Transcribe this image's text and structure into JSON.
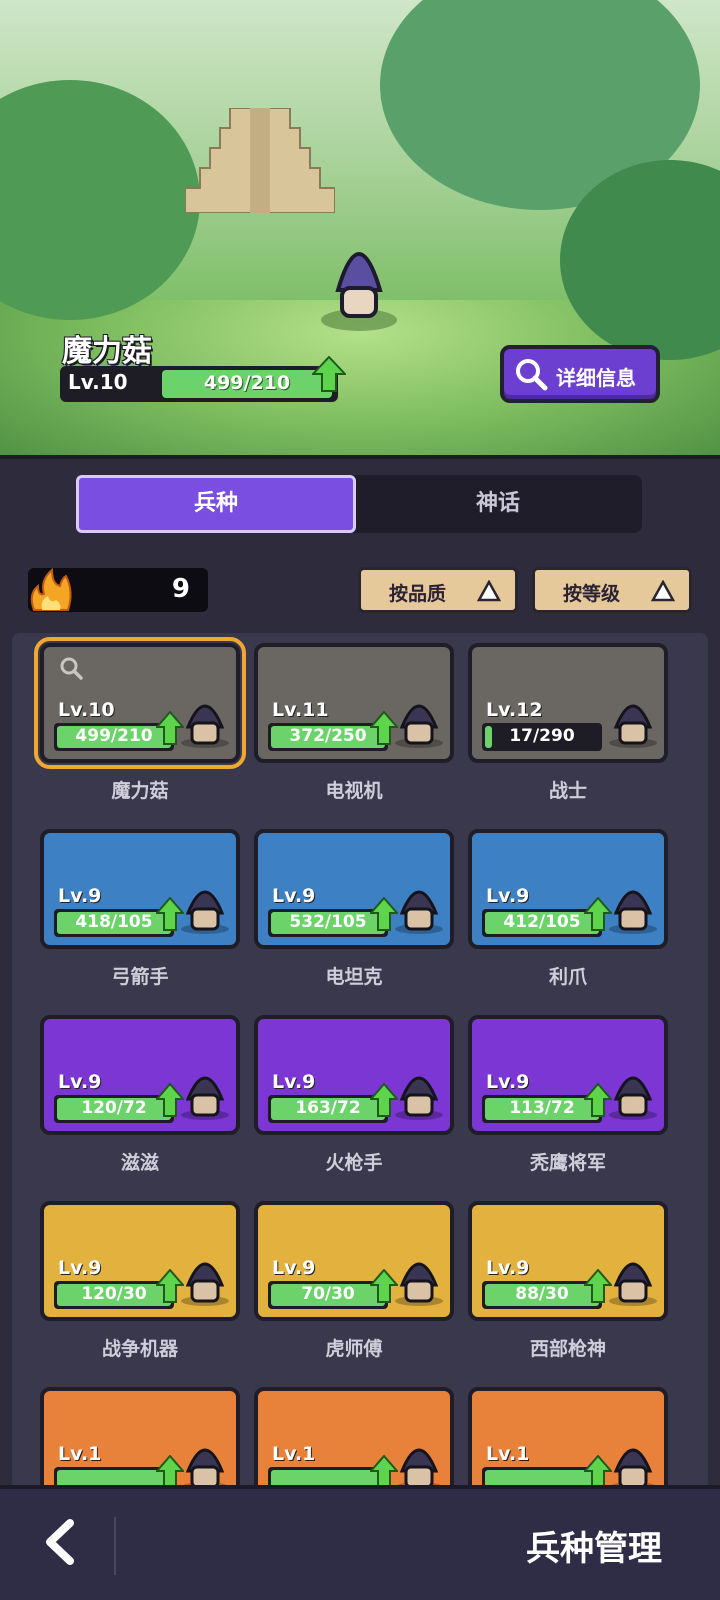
{
  "hero": {
    "unit_name": "魔力菇",
    "level": "Lv.10",
    "progress_text": "499/210",
    "progress_fraction": 1.0,
    "detail_button": "详细信息"
  },
  "tabs": [
    {
      "label": "兵种",
      "active": true
    },
    {
      "label": "神话",
      "active": false
    }
  ],
  "resource": {
    "icon": "fire-icon",
    "count": "9"
  },
  "sort_buttons": [
    {
      "label": "按品质",
      "icon": "triangle-up-icon"
    },
    {
      "label": "按等级",
      "icon": "triangle-up-icon"
    }
  ],
  "units": [
    {
      "name": "魔力菇",
      "level": "Lv.10",
      "progress": "499/210",
      "fraction": 1.0,
      "upgrade": true,
      "rarity": "gray",
      "selected": true,
      "color": "#6a6661"
    },
    {
      "name": "电视机",
      "level": "Lv.11",
      "progress": "372/250",
      "fraction": 1.0,
      "upgrade": true,
      "rarity": "gray",
      "selected": false,
      "color": "#6a6661"
    },
    {
      "name": "战士",
      "level": "Lv.12",
      "progress": "17/290",
      "fraction": 0.06,
      "upgrade": false,
      "rarity": "gray",
      "selected": false,
      "color": "#6a6661"
    },
    {
      "name": "弓箭手",
      "level": "Lv.9",
      "progress": "418/105",
      "fraction": 1.0,
      "upgrade": true,
      "rarity": "blue",
      "selected": false,
      "color": "#3d80c4"
    },
    {
      "name": "电坦克",
      "level": "Lv.9",
      "progress": "532/105",
      "fraction": 1.0,
      "upgrade": true,
      "rarity": "blue",
      "selected": false,
      "color": "#3d80c4"
    },
    {
      "name": "利爪",
      "level": "Lv.9",
      "progress": "412/105",
      "fraction": 1.0,
      "upgrade": true,
      "rarity": "blue",
      "selected": false,
      "color": "#3d80c4"
    },
    {
      "name": "滋滋",
      "level": "Lv.9",
      "progress": "120/72",
      "fraction": 1.0,
      "upgrade": true,
      "rarity": "purple",
      "selected": false,
      "color": "#7b36d4"
    },
    {
      "name": "火枪手",
      "level": "Lv.9",
      "progress": "163/72",
      "fraction": 1.0,
      "upgrade": true,
      "rarity": "purple",
      "selected": false,
      "color": "#7b36d4"
    },
    {
      "name": "秃鹰将军",
      "level": "Lv.9",
      "progress": "113/72",
      "fraction": 1.0,
      "upgrade": true,
      "rarity": "purple",
      "selected": false,
      "color": "#7b36d4"
    },
    {
      "name": "战争机器",
      "level": "Lv.9",
      "progress": "120/30",
      "fraction": 1.0,
      "upgrade": true,
      "rarity": "gold",
      "selected": false,
      "color": "#e3b23e"
    },
    {
      "name": "虎师傅",
      "level": "Lv.9",
      "progress": "70/30",
      "fraction": 1.0,
      "upgrade": true,
      "rarity": "gold",
      "selected": false,
      "color": "#e3b23e"
    },
    {
      "name": "西部枪神",
      "level": "Lv.9",
      "progress": "88/30",
      "fraction": 1.0,
      "upgrade": true,
      "rarity": "gold",
      "selected": false,
      "color": "#e3b23e"
    },
    {
      "name": "",
      "level": "Lv.1",
      "progress": "",
      "fraction": 1.0,
      "upgrade": true,
      "rarity": "orange",
      "selected": false,
      "color": "#e8813a"
    },
    {
      "name": "",
      "level": "Lv.1",
      "progress": "",
      "fraction": 1.0,
      "upgrade": true,
      "rarity": "orange",
      "selected": false,
      "color": "#e8813a"
    },
    {
      "name": "",
      "level": "Lv.1",
      "progress": "",
      "fraction": 1.0,
      "upgrade": true,
      "rarity": "orange",
      "selected": false,
      "color": "#e8813a"
    }
  ],
  "bottom_bar": {
    "back_icon": "chevron-left-icon",
    "title": "兵种管理"
  },
  "colors": {
    "accent": "#7a4ee0",
    "progress": "#6cd36a",
    "upgrade_arrow": "#5ed34c"
  }
}
